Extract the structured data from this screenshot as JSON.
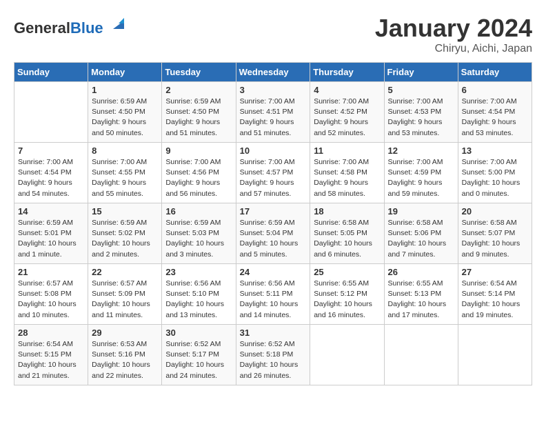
{
  "header": {
    "logo_general": "General",
    "logo_blue": "Blue",
    "month_year": "January 2024",
    "location": "Chiryu, Aichi, Japan"
  },
  "weekdays": [
    "Sunday",
    "Monday",
    "Tuesday",
    "Wednesday",
    "Thursday",
    "Friday",
    "Saturday"
  ],
  "weeks": [
    [
      {
        "day": "",
        "info": ""
      },
      {
        "day": "1",
        "info": "Sunrise: 6:59 AM\nSunset: 4:50 PM\nDaylight: 9 hours\nand 50 minutes."
      },
      {
        "day": "2",
        "info": "Sunrise: 6:59 AM\nSunset: 4:50 PM\nDaylight: 9 hours\nand 51 minutes."
      },
      {
        "day": "3",
        "info": "Sunrise: 7:00 AM\nSunset: 4:51 PM\nDaylight: 9 hours\nand 51 minutes."
      },
      {
        "day": "4",
        "info": "Sunrise: 7:00 AM\nSunset: 4:52 PM\nDaylight: 9 hours\nand 52 minutes."
      },
      {
        "day": "5",
        "info": "Sunrise: 7:00 AM\nSunset: 4:53 PM\nDaylight: 9 hours\nand 53 minutes."
      },
      {
        "day": "6",
        "info": "Sunrise: 7:00 AM\nSunset: 4:54 PM\nDaylight: 9 hours\nand 53 minutes."
      }
    ],
    [
      {
        "day": "7",
        "info": "Sunrise: 7:00 AM\nSunset: 4:54 PM\nDaylight: 9 hours\nand 54 minutes."
      },
      {
        "day": "8",
        "info": "Sunrise: 7:00 AM\nSunset: 4:55 PM\nDaylight: 9 hours\nand 55 minutes."
      },
      {
        "day": "9",
        "info": "Sunrise: 7:00 AM\nSunset: 4:56 PM\nDaylight: 9 hours\nand 56 minutes."
      },
      {
        "day": "10",
        "info": "Sunrise: 7:00 AM\nSunset: 4:57 PM\nDaylight: 9 hours\nand 57 minutes."
      },
      {
        "day": "11",
        "info": "Sunrise: 7:00 AM\nSunset: 4:58 PM\nDaylight: 9 hours\nand 58 minutes."
      },
      {
        "day": "12",
        "info": "Sunrise: 7:00 AM\nSunset: 4:59 PM\nDaylight: 9 hours\nand 59 minutes."
      },
      {
        "day": "13",
        "info": "Sunrise: 7:00 AM\nSunset: 5:00 PM\nDaylight: 10 hours\nand 0 minutes."
      }
    ],
    [
      {
        "day": "14",
        "info": "Sunrise: 6:59 AM\nSunset: 5:01 PM\nDaylight: 10 hours\nand 1 minute."
      },
      {
        "day": "15",
        "info": "Sunrise: 6:59 AM\nSunset: 5:02 PM\nDaylight: 10 hours\nand 2 minutes."
      },
      {
        "day": "16",
        "info": "Sunrise: 6:59 AM\nSunset: 5:03 PM\nDaylight: 10 hours\nand 3 minutes."
      },
      {
        "day": "17",
        "info": "Sunrise: 6:59 AM\nSunset: 5:04 PM\nDaylight: 10 hours\nand 5 minutes."
      },
      {
        "day": "18",
        "info": "Sunrise: 6:58 AM\nSunset: 5:05 PM\nDaylight: 10 hours\nand 6 minutes."
      },
      {
        "day": "19",
        "info": "Sunrise: 6:58 AM\nSunset: 5:06 PM\nDaylight: 10 hours\nand 7 minutes."
      },
      {
        "day": "20",
        "info": "Sunrise: 6:58 AM\nSunset: 5:07 PM\nDaylight: 10 hours\nand 9 minutes."
      }
    ],
    [
      {
        "day": "21",
        "info": "Sunrise: 6:57 AM\nSunset: 5:08 PM\nDaylight: 10 hours\nand 10 minutes."
      },
      {
        "day": "22",
        "info": "Sunrise: 6:57 AM\nSunset: 5:09 PM\nDaylight: 10 hours\nand 11 minutes."
      },
      {
        "day": "23",
        "info": "Sunrise: 6:56 AM\nSunset: 5:10 PM\nDaylight: 10 hours\nand 13 minutes."
      },
      {
        "day": "24",
        "info": "Sunrise: 6:56 AM\nSunset: 5:11 PM\nDaylight: 10 hours\nand 14 minutes."
      },
      {
        "day": "25",
        "info": "Sunrise: 6:55 AM\nSunset: 5:12 PM\nDaylight: 10 hours\nand 16 minutes."
      },
      {
        "day": "26",
        "info": "Sunrise: 6:55 AM\nSunset: 5:13 PM\nDaylight: 10 hours\nand 17 minutes."
      },
      {
        "day": "27",
        "info": "Sunrise: 6:54 AM\nSunset: 5:14 PM\nDaylight: 10 hours\nand 19 minutes."
      }
    ],
    [
      {
        "day": "28",
        "info": "Sunrise: 6:54 AM\nSunset: 5:15 PM\nDaylight: 10 hours\nand 21 minutes."
      },
      {
        "day": "29",
        "info": "Sunrise: 6:53 AM\nSunset: 5:16 PM\nDaylight: 10 hours\nand 22 minutes."
      },
      {
        "day": "30",
        "info": "Sunrise: 6:52 AM\nSunset: 5:17 PM\nDaylight: 10 hours\nand 24 minutes."
      },
      {
        "day": "31",
        "info": "Sunrise: 6:52 AM\nSunset: 5:18 PM\nDaylight: 10 hours\nand 26 minutes."
      },
      {
        "day": "",
        "info": ""
      },
      {
        "day": "",
        "info": ""
      },
      {
        "day": "",
        "info": ""
      }
    ]
  ]
}
